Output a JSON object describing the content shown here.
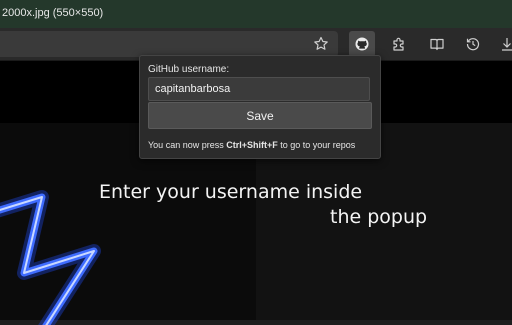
{
  "window": {
    "tab_title": "2000x.jpg (550×550)"
  },
  "toolbar": {
    "icons": [
      "star-icon",
      "github-icon",
      "puzzle-icon",
      "reading-view-icon",
      "history-icon",
      "download-icon"
    ]
  },
  "popup": {
    "label": "GitHub username:",
    "username_value": "capitanbarbosa",
    "save_label": "Save",
    "hint_prefix": "You can now press ",
    "hint_shortcut": "Ctrl+Shift+F",
    "hint_suffix": " to go to your repos"
  },
  "page": {
    "caption_line1": "Enter your username inside",
    "caption_line2": "the popup"
  },
  "colors": {
    "titlebar": "#24382b",
    "neon": "#2b5cff"
  }
}
